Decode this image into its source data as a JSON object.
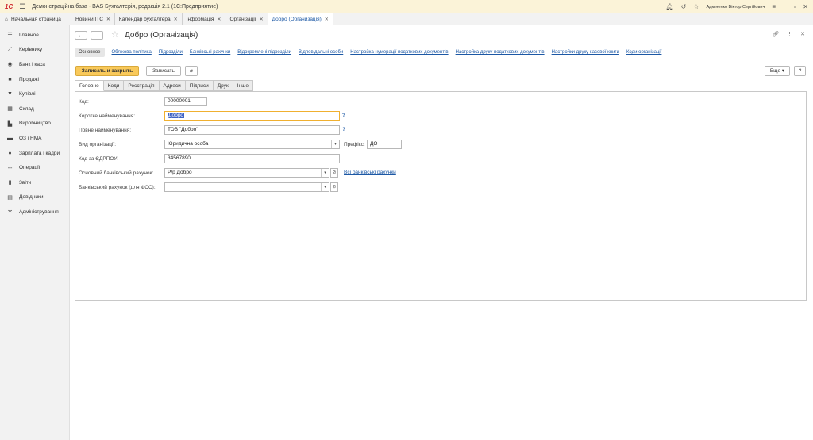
{
  "app": {
    "logo": "1С",
    "title": "Демонстраційна база - BAS Бухгалтерія, редакція 2.1  (1С:Предприятие)",
    "user": "Адміненко Віктор Сергійович"
  },
  "tabs": {
    "home": "Начальная страница",
    "open": [
      {
        "label": "Новини ІТС"
      },
      {
        "label": "Календар бухгалтера"
      },
      {
        "label": "Інформація"
      },
      {
        "label": "Організації"
      },
      {
        "label": "Добро (Организація)"
      }
    ]
  },
  "sidebar": {
    "items": [
      {
        "label": "Главное",
        "icon": "menu-icon"
      },
      {
        "label": "Керівнику",
        "icon": "chart-icon"
      },
      {
        "label": "Банк і каса",
        "icon": "bank-icon"
      },
      {
        "label": "Продажі",
        "icon": "bag-icon"
      },
      {
        "label": "Купівлі",
        "icon": "cart-icon"
      },
      {
        "label": "Склад",
        "icon": "warehouse-icon"
      },
      {
        "label": "Виробництво",
        "icon": "factory-icon"
      },
      {
        "label": "ОЗ і НМА",
        "icon": "truck-icon"
      },
      {
        "label": "Зарплата і кадри",
        "icon": "person-icon"
      },
      {
        "label": "Операції",
        "icon": "operations-icon"
      },
      {
        "label": "Звіти",
        "icon": "report-icon"
      },
      {
        "label": "Довідники",
        "icon": "book-icon"
      },
      {
        "label": "Адміністрування",
        "icon": "gear-icon"
      }
    ]
  },
  "form": {
    "title": "Добро (Організація)",
    "nav_links": {
      "active": "Основное",
      "links": [
        "Облікова політика",
        "Підрозділи",
        "Банківські рахунки",
        "Відокремлені підрозділи",
        "Відповідальні особи",
        "Настройка нумерації податкових документів",
        "Настройка друку податкових документів",
        "Настройки друку касової книги",
        "Коди організації"
      ]
    },
    "buttons": {
      "save_close": "Записать и закрыть",
      "save": "Записать",
      "more": "Еще",
      "help": "?"
    },
    "form_tabs": [
      "Головне",
      "Коди",
      "Реєстрація",
      "Адреси",
      "Підписи",
      "Друк",
      "Інше"
    ],
    "fields": {
      "code_label": "Код:",
      "code_value": "00000001",
      "short_name_label": "Коротке найменування:",
      "short_name_value": "Добро",
      "full_name_label": "Повне найменування:",
      "full_name_value": "ТОВ \"Добро\"",
      "org_type_label": "Вид організації:",
      "org_type_value": "Юридична особа",
      "prefix_label": "Префікс:",
      "prefix_value": "ДО",
      "edrpou_label": "Код за ЄДРПОУ:",
      "edrpou_value": "34567890",
      "bank_account_label": "Основний банківський рахунок:",
      "bank_account_value": "Р/р Добро",
      "all_accounts_link": "Всі банківські рахунки",
      "fss_account_label": "Банківський рахунок (для ФСС):",
      "fss_account_value": "",
      "hint": "?"
    }
  }
}
